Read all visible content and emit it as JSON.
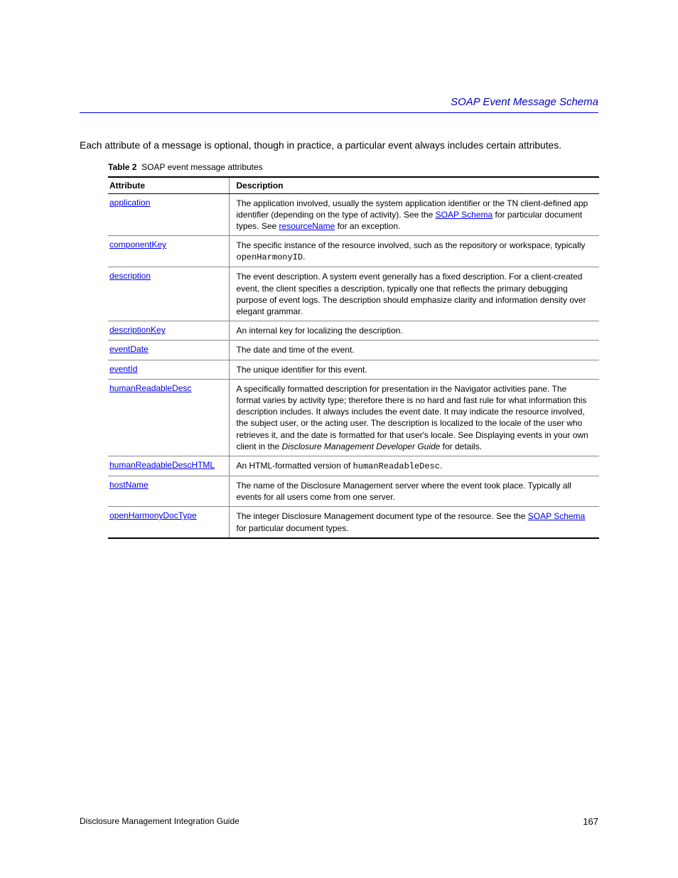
{
  "header": {
    "running_title": "SOAP Event Message Schema"
  },
  "intro": "Each attribute of a message is optional, though in practice, a particular event always includes certain attributes.",
  "table": {
    "caption_number": "Table 2",
    "caption_text": "SOAP event message attributes",
    "columns": [
      "Attribute",
      "Description"
    ],
    "rows": [
      {
        "attr": "application",
        "desc_parts": [
          {
            "t": "The application involved, usually the system application identifier or the TN client-defined app identifier (depending on the type of activity). See the ",
            "k": "text"
          },
          {
            "t": "SOAP Schema",
            "k": "link"
          },
          {
            "t": " for particular document types. See ",
            "k": "text"
          },
          {
            "t": "resourceName",
            "k": "link"
          },
          {
            "t": " for an exception.",
            "k": "text"
          }
        ]
      },
      {
        "attr": "componentKey",
        "desc_parts": [
          {
            "t": "The specific instance of the resource involved, such as the repository or workspace, typically ",
            "k": "text"
          },
          {
            "t": "openHarmonyID",
            "k": "mono"
          },
          {
            "t": ".",
            "k": "text"
          }
        ]
      },
      {
        "attr": "description",
        "desc_parts": [
          {
            "t": "The event description. A system event generally has a fixed description. For a client-created event, the client specifies a description, typically one that reflects the primary debugging purpose of event logs. The description should emphasize clarity and information density over elegant grammar.",
            "k": "text"
          }
        ]
      },
      {
        "attr": "descriptionKey",
        "desc_parts": [
          {
            "t": "An internal key for localizing the description.",
            "k": "text"
          }
        ]
      },
      {
        "attr": "eventDate",
        "desc_parts": [
          {
            "t": "The date and time of the event.",
            "k": "text"
          }
        ]
      },
      {
        "attr": "eventId",
        "desc_parts": [
          {
            "t": "The unique identifier for this event.",
            "k": "text"
          }
        ]
      },
      {
        "attr": "humanReadableDesc",
        "desc_parts": [
          {
            "t": "A specifically formatted description for presentation in the Navigator activities pane. The format varies by activity type; therefore there is no hard and fast rule for what information this description includes. It always includes the event date. It may indicate the resource involved, the subject user, or the acting user. The description is localized to the locale of the user who retrieves it, and the date is formatted for that user's locale. See Displaying events in your own client in the ",
            "k": "text"
          },
          {
            "t": "Disclosure Management Developer Guide",
            "k": "italic"
          },
          {
            "t": " for details.",
            "k": "text"
          }
        ]
      },
      {
        "attr": "humanReadableDescHTML",
        "desc_parts": [
          {
            "t": "An HTML-formatted version of ",
            "k": "text"
          },
          {
            "t": "humanReadableDesc",
            "k": "mono"
          },
          {
            "t": ".",
            "k": "text"
          }
        ]
      },
      {
        "attr": "hostName",
        "desc_parts": [
          {
            "t": "The name of the Disclosure Management server where the event took place. Typically all events for all users come from one server.",
            "k": "text"
          }
        ]
      },
      {
        "attr": "openHarmonyDocType",
        "desc_parts": [
          {
            "t": "The integer Disclosure Management document type of the resource. See the ",
            "k": "text"
          },
          {
            "t": "SOAP Schema",
            "k": "link"
          },
          {
            "t": " for particular document types.",
            "k": "text"
          }
        ]
      }
    ]
  },
  "footer": {
    "doc_title": "Disclosure Management Integration Guide",
    "page_number": "167"
  }
}
